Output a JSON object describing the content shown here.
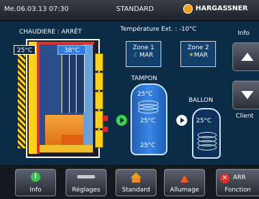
{
  "header": {
    "datetime": "Me.06.03.13 07:30",
    "mode": "STANDARD",
    "brand": "HARGASSNER"
  },
  "boiler": {
    "status_label": "CHAUDIERE : ARRÊT",
    "temp_left": "25°C",
    "temp_right": "38°C"
  },
  "outdoor": {
    "label": "Température Ext. : -10°C"
  },
  "zones": [
    {
      "name": "Zone 1",
      "mode": "MAR"
    },
    {
      "name": "Zone 2",
      "mode": "MAR"
    }
  ],
  "tampon": {
    "label": "TAMPON",
    "temp_top": "25°C",
    "temp_mid": "25°C",
    "temp_bottom": "25°C"
  },
  "ballon": {
    "label": "BALLON",
    "temp": "25°C"
  },
  "side": {
    "info_label": "Info",
    "client_label": "Client"
  },
  "toolbar": {
    "info": "Info",
    "reglages": "Réglages",
    "standard": "Standard",
    "allumage": "Allumage",
    "arr": "ARR",
    "fonction": "Fonction"
  },
  "colors": {
    "background": "#0a2c47",
    "accent_yellow": "#ffd21a",
    "fire_orange": "#f08a2a",
    "tank_blue": "#3a86e6",
    "pump_green": "#3bd14a"
  }
}
